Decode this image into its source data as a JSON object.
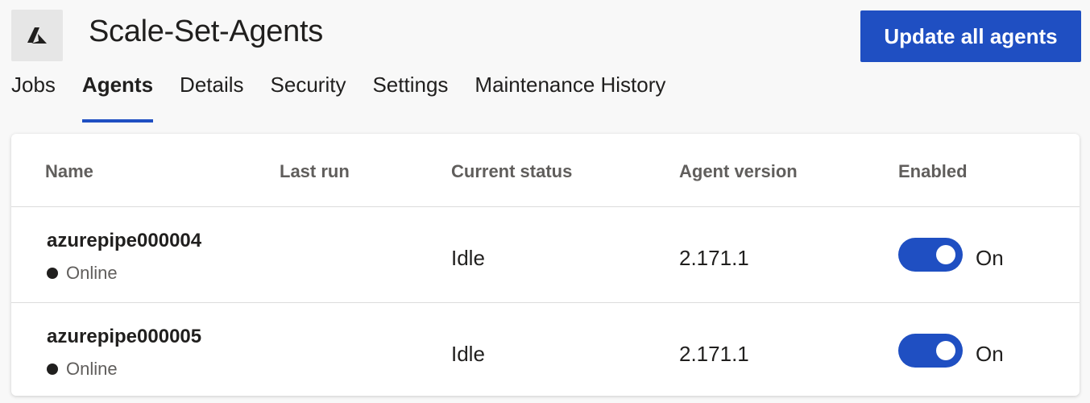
{
  "header": {
    "title": "Scale-Set-Agents",
    "update_button_label": "Update all agents",
    "pool_icon": "azure-logo-icon"
  },
  "tabs": [
    {
      "label": "Jobs",
      "active": false
    },
    {
      "label": "Agents",
      "active": true
    },
    {
      "label": "Details",
      "active": false
    },
    {
      "label": "Security",
      "active": false
    },
    {
      "label": "Settings",
      "active": false
    },
    {
      "label": "Maintenance History",
      "active": false
    }
  ],
  "table": {
    "columns": [
      "Name",
      "Last run",
      "Current status",
      "Agent version",
      "Enabled"
    ],
    "rows": [
      {
        "name": "azurepipe000004",
        "online_status": "Online",
        "last_run": "",
        "current_status": "Idle",
        "agent_version": "2.171.1",
        "enabled": true,
        "enabled_label": "On"
      },
      {
        "name": "azurepipe000005",
        "online_status": "Online",
        "last_run": "",
        "current_status": "Idle",
        "agent_version": "2.171.1",
        "enabled": true,
        "enabled_label": "On"
      }
    ]
  },
  "colors": {
    "accent": "#1f4fc2",
    "background": "#f8f8f8",
    "card": "#ffffff"
  }
}
